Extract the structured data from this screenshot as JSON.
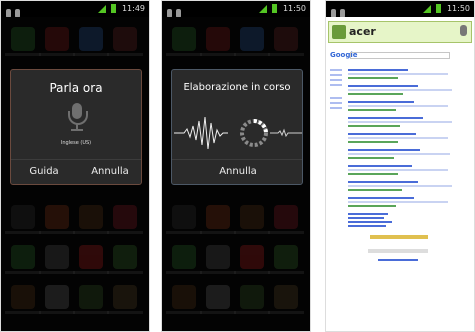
{
  "screens": [
    {
      "status": {
        "time": "11:49"
      },
      "dialog": {
        "title": "Parla ora",
        "language": "Inglese (US)",
        "buttons": {
          "left": "Guida",
          "right": "Annulla"
        }
      }
    },
    {
      "status": {
        "time": "11:50"
      },
      "dialog": {
        "title": "Elaborazione in corso",
        "buttons": {
          "single": "Annulla"
        }
      }
    },
    {
      "status": {
        "time": "11:50"
      },
      "browser": {
        "query": "acer",
        "logo_text": "Google"
      }
    }
  ],
  "icons": {
    "mic": "microphone-icon",
    "signal": "signal-icon",
    "battery": "battery-icon"
  }
}
